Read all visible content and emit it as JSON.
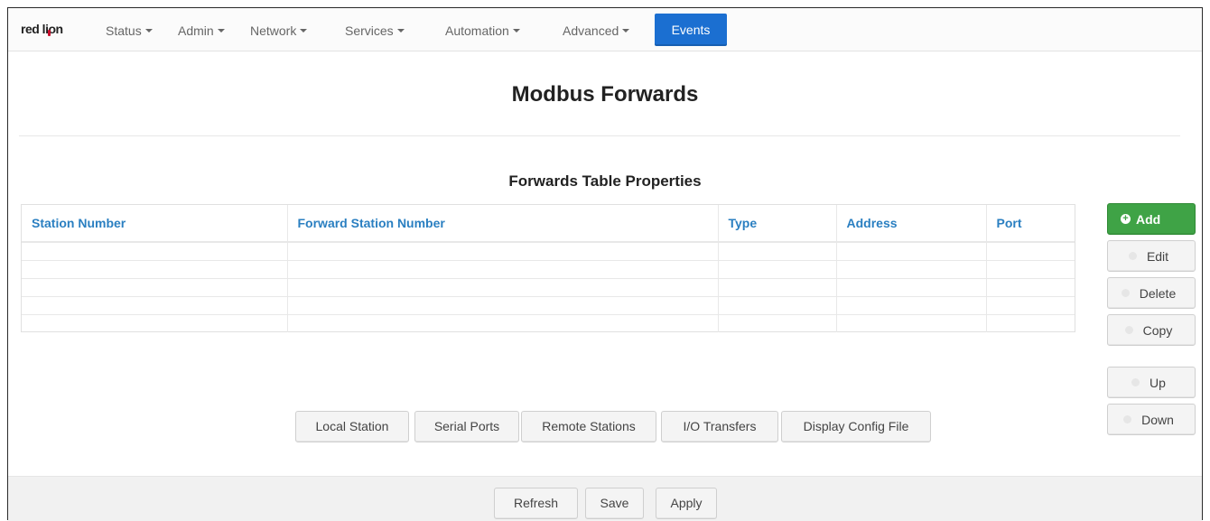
{
  "brand": {
    "logo_text_1": "red l",
    "logo_text_2": "i",
    "logo_text_3": "on"
  },
  "nav": {
    "items": [
      {
        "label": "Status"
      },
      {
        "label": "Admin"
      },
      {
        "label": "Network"
      },
      {
        "label": "Services"
      },
      {
        "label": "Automation"
      },
      {
        "label": "Advanced"
      }
    ],
    "events_label": "Events"
  },
  "page": {
    "title": "Modbus Forwards",
    "section_title": "Forwards Table Properties"
  },
  "table": {
    "columns": [
      "Station Number",
      "Forward Station Number",
      "Type",
      "Address",
      "Port"
    ],
    "rows": [
      [
        "",
        "",
        "",
        "",
        ""
      ],
      [
        "",
        "",
        "",
        "",
        ""
      ],
      [
        "",
        "",
        "",
        "",
        ""
      ],
      [
        "",
        "",
        "",
        "",
        ""
      ],
      [
        "",
        "",
        "",
        "",
        ""
      ]
    ]
  },
  "side_buttons": {
    "add": "Add",
    "edit": "Edit",
    "delete": "Delete",
    "copy": "Copy",
    "up": "Up",
    "down": "Down"
  },
  "nav_buttons": {
    "local_station": "Local Station",
    "serial_ports": "Serial Ports",
    "remote_stations": "Remote Stations",
    "io_transfers": "I/O Transfers",
    "display_config": "Display Config File"
  },
  "footer": {
    "refresh": "Refresh",
    "save": "Save",
    "apply": "Apply"
  },
  "colors": {
    "accent_blue": "#1b6fd1",
    "link_blue": "#2a7fc1",
    "add_green": "#3fa346",
    "logo_red": "#c8102e"
  }
}
